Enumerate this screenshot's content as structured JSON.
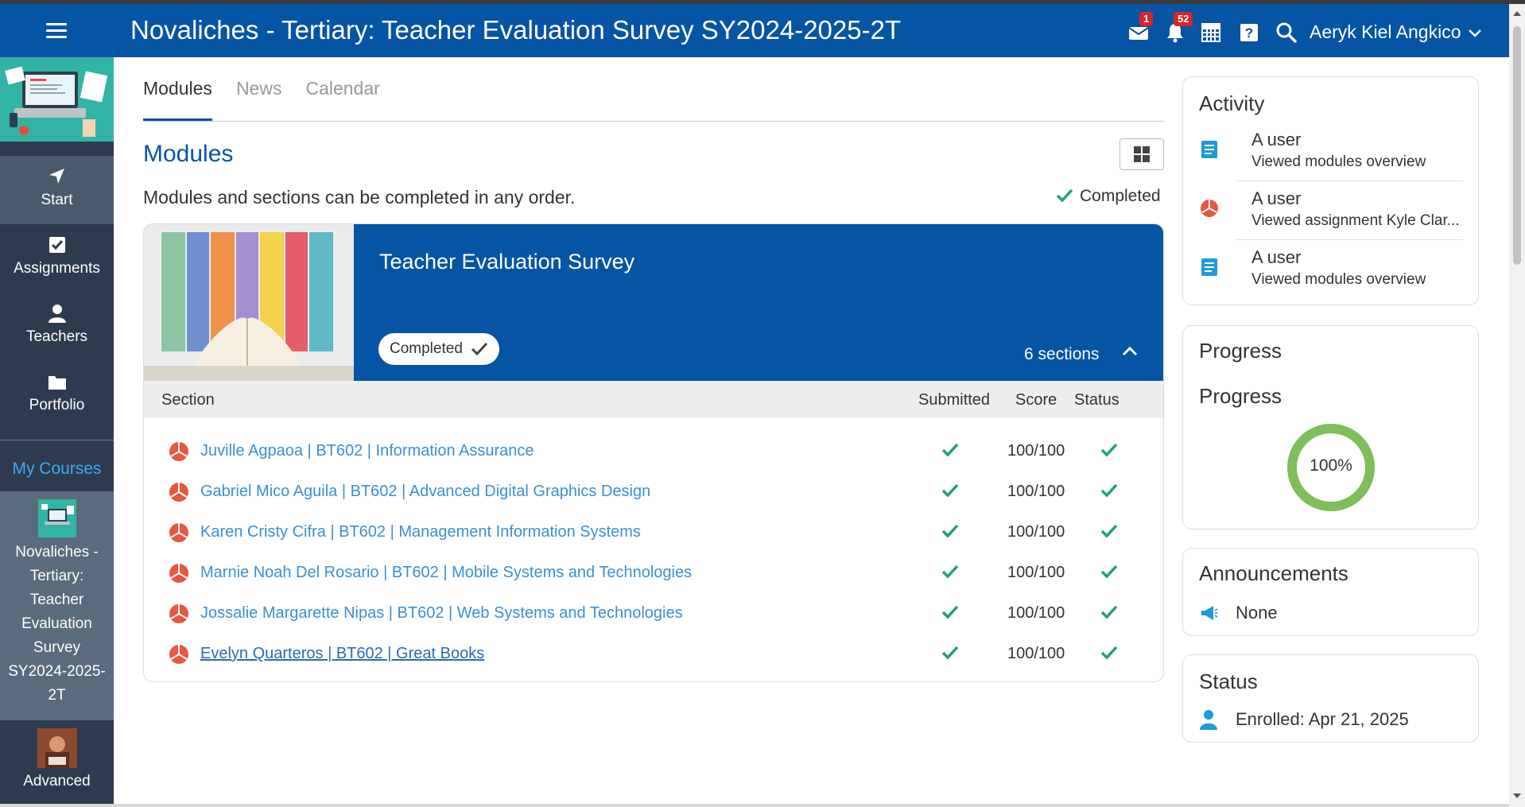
{
  "header": {
    "title": "Novaliches - Tertiary: Teacher Evaluation Survey SY2024-2025-2T",
    "mail_badge": "1",
    "notif_badge": "52",
    "user_name": "Aeryk Kiel Angkico",
    "accent_color": "#0654a4"
  },
  "sidebar": {
    "nav": [
      {
        "label": "Start",
        "icon": "navigation-arrow-icon"
      },
      {
        "label": "Assignments",
        "icon": "check-document-icon"
      },
      {
        "label": "Teachers",
        "icon": "person-icon"
      },
      {
        "label": "Portfolio",
        "icon": "folder-icon"
      }
    ],
    "my_courses_label": "My Courses",
    "courses": [
      {
        "label": "Novaliches - Tertiary: Teacher Evaluation Survey SY2024-2025-2T"
      },
      {
        "label": "Advanced"
      }
    ]
  },
  "tabs": [
    "Modules",
    "News",
    "Calendar"
  ],
  "main": {
    "heading": "Modules",
    "order_text": "Modules and sections can be completed in any order.",
    "completed_label": "Completed"
  },
  "module": {
    "name": "Teacher Evaluation Survey",
    "status_pill": "Completed",
    "sections_count": "6 sections",
    "columns": {
      "section": "Section",
      "submitted": "Submitted",
      "score": "Score",
      "status": "Status"
    },
    "rows": [
      {
        "title": "Juville Agpaoa | BT602 | Information Assurance",
        "score": "100/100"
      },
      {
        "title": "Gabriel Mico Aguila | BT602 | Advanced Digital Graphics Design",
        "score": "100/100"
      },
      {
        "title": "Karen Cristy Cifra | BT602 | Management Information Systems",
        "score": "100/100"
      },
      {
        "title": "Marnie Noah Del Rosario | BT602 | Mobile Systems and Technologies",
        "score": "100/100"
      },
      {
        "title": "Jossalie Margarette Nipas | BT602 | Web Systems and Technologies",
        "score": "100/100"
      },
      {
        "title": "Evelyn Quarteros | BT602 | Great Books",
        "score": "100/100"
      }
    ]
  },
  "activity": {
    "title": "Activity",
    "items": [
      {
        "who": "A user",
        "what": "Viewed modules overview",
        "icon": "module-book-icon"
      },
      {
        "who": "A user",
        "what": "Viewed assignment Kyle Clar...",
        "icon": "assignment-pie-icon"
      },
      {
        "who": "A user",
        "what": "Viewed modules overview",
        "icon": "module-book-icon"
      }
    ]
  },
  "progress": {
    "title": "Progress",
    "subtitle": "Progress",
    "value_label": "100%",
    "fraction": 1.0
  },
  "announcements": {
    "title": "Announcements",
    "value": "None"
  },
  "status": {
    "title": "Status",
    "value": "Enrolled: Apr 21, 2025"
  }
}
